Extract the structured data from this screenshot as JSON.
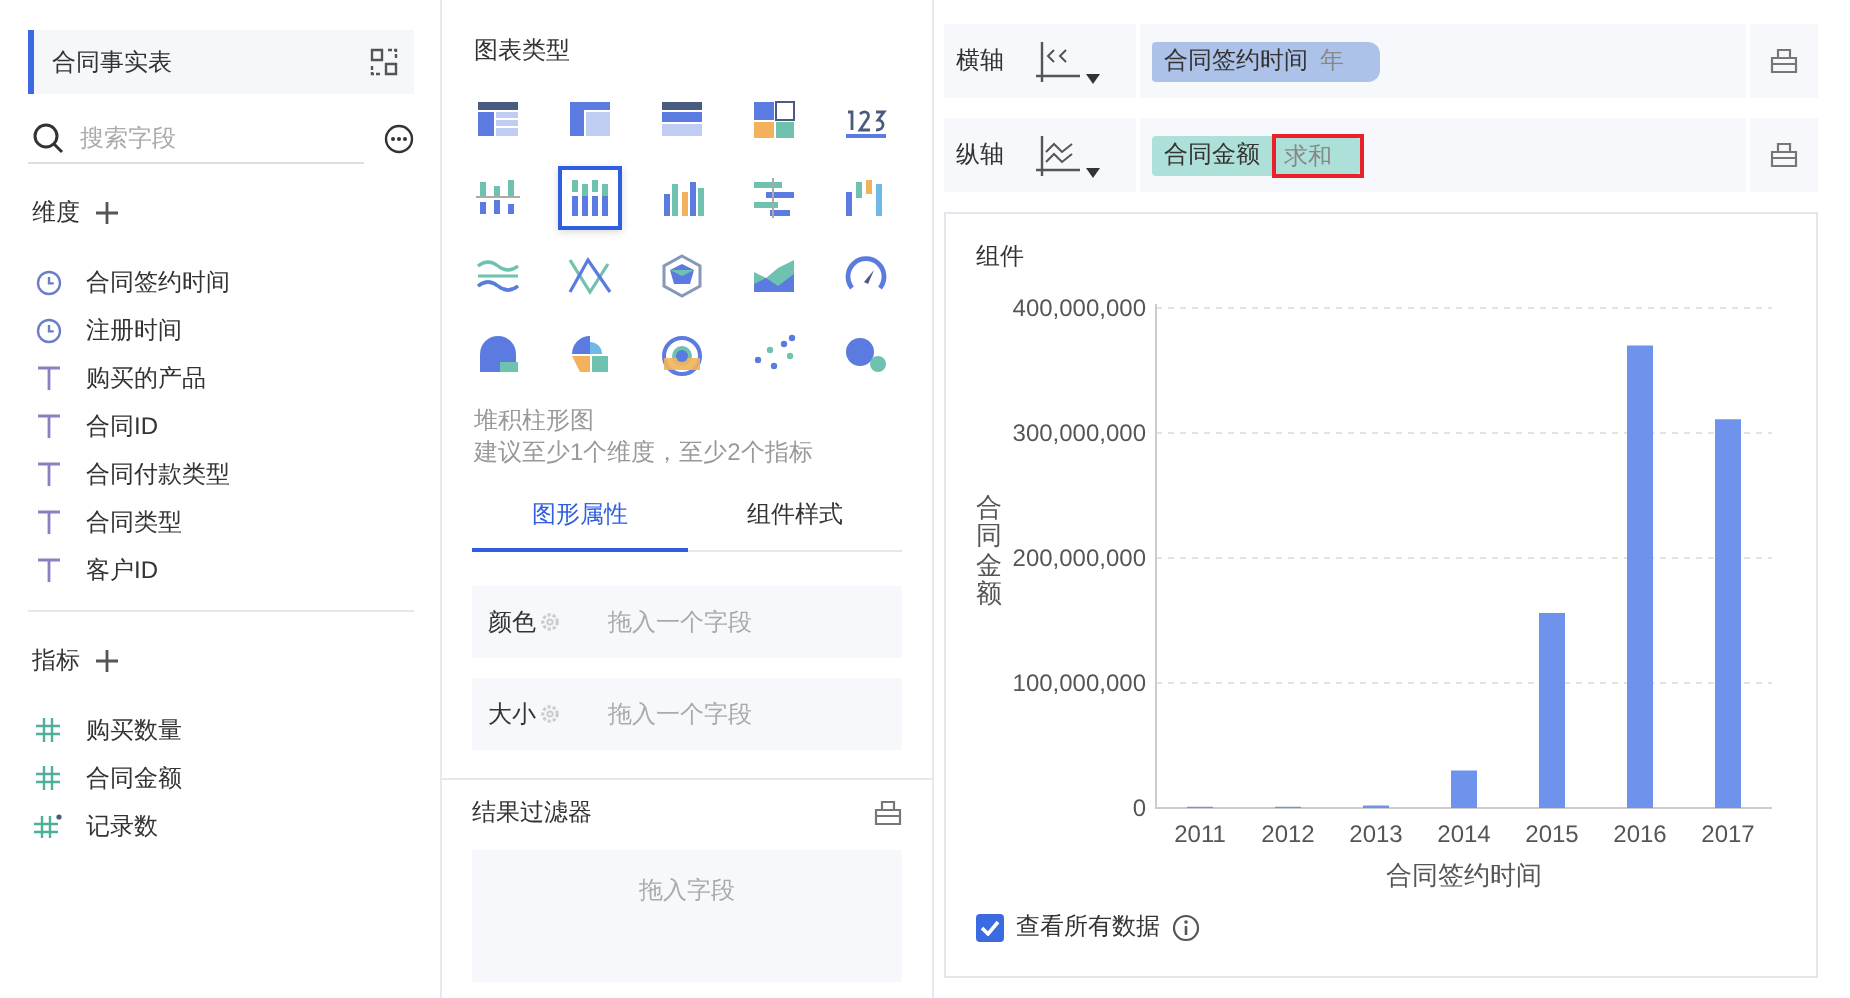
{
  "dataset": {
    "title": "合同事实表"
  },
  "search": {
    "placeholder": "搜索字段"
  },
  "dimensions": {
    "title": "维度",
    "items": [
      {
        "label": "合同签约时间",
        "kind": "date"
      },
      {
        "label": "注册时间",
        "kind": "date"
      },
      {
        "label": "购买的产品",
        "kind": "text"
      },
      {
        "label": "合同ID",
        "kind": "text"
      },
      {
        "label": "合同付款类型",
        "kind": "text"
      },
      {
        "label": "合同类型",
        "kind": "text"
      },
      {
        "label": "客户ID",
        "kind": "text"
      }
    ]
  },
  "measures": {
    "title": "指标",
    "items": [
      {
        "label": "购买数量",
        "kind": "number"
      },
      {
        "label": "合同金额",
        "kind": "number"
      },
      {
        "label": "记录数",
        "kind": "count"
      }
    ]
  },
  "chart_types": {
    "title": "图表类型",
    "items": [
      {
        "kind": "table",
        "selected": false
      },
      {
        "kind": "cross-table",
        "selected": false
      },
      {
        "kind": "detail-table",
        "selected": false
      },
      {
        "kind": "tiles",
        "selected": false
      },
      {
        "kind": "number",
        "selected": false
      },
      {
        "kind": "dot-bars",
        "selected": false
      },
      {
        "kind": "stacked-columns",
        "selected": true
      },
      {
        "kind": "columns",
        "selected": false
      },
      {
        "kind": "range-bars",
        "selected": false
      },
      {
        "kind": "waterfall",
        "selected": false
      },
      {
        "kind": "waves",
        "selected": false
      },
      {
        "kind": "lines",
        "selected": false
      },
      {
        "kind": "radar",
        "selected": false
      },
      {
        "kind": "area",
        "selected": false
      },
      {
        "kind": "gauge",
        "selected": false
      },
      {
        "kind": "pie",
        "selected": false
      },
      {
        "kind": "rose",
        "selected": false
      },
      {
        "kind": "sunburst",
        "selected": false
      },
      {
        "kind": "scatter",
        "selected": false
      },
      {
        "kind": "bubble",
        "selected": false
      }
    ],
    "name": "堆积柱形图",
    "hint": "建议至少1个维度，至少2个指标"
  },
  "property_tabs": [
    {
      "label": "图形属性",
      "selected": true
    },
    {
      "label": "组件样式",
      "selected": false
    }
  ],
  "properties": [
    {
      "label": "颜色",
      "placeholder": "拖入一个字段"
    },
    {
      "label": "大小",
      "placeholder": "拖入一个字段"
    }
  ],
  "filter": {
    "title": "结果过滤器",
    "placeholder": "拖入字段"
  },
  "axes": [
    {
      "label": "横轴",
      "kind": "x",
      "field": "合同签约时间",
      "aggregation": "年",
      "highlighted": false
    },
    {
      "label": "纵轴",
      "kind": "y",
      "field": "合同金额",
      "aggregation": "求和",
      "highlighted": true
    }
  ],
  "widget": {
    "title": "组件",
    "show_all": {
      "label": "查看所有数据",
      "checked": true
    },
    "chart_data": {
      "type": "bar",
      "xlabel": "合同签约时间",
      "ylabel": "合同金额",
      "categories": [
        "2011",
        "2012",
        "2013",
        "2014",
        "2015",
        "2016",
        "2017"
      ],
      "series": [
        {
          "color": "#6f93ec",
          "values": [
            1000000,
            1000000,
            2000000,
            30000000,
            156000000,
            370000000,
            311000000
          ]
        }
      ],
      "ylim": [
        0,
        400000000
      ],
      "grid": true,
      "yticks": [
        {
          "value": 0,
          "label": "0"
        },
        {
          "value": 100000000,
          "label": "100,000,000"
        },
        {
          "value": 200000000,
          "label": "200,000,000"
        },
        {
          "value": 300000000,
          "label": "300,000,000"
        },
        {
          "value": 400000000,
          "label": "400,000,000"
        }
      ]
    }
  }
}
